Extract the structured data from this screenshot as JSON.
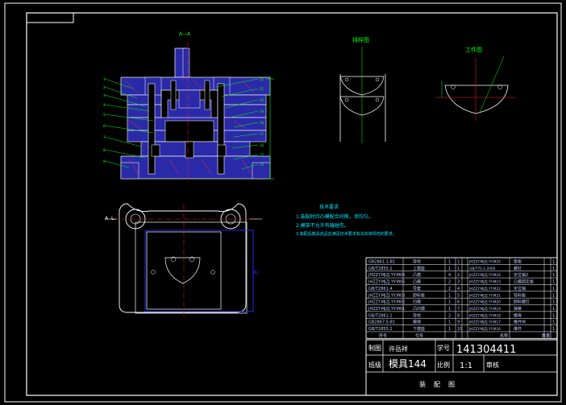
{
  "colors": {
    "background": "#000000",
    "frame": "#ffffff",
    "part_fill": "#2a2aa8",
    "part_line": "#ffffff",
    "leader": "#00ff00",
    "centerline": "#ff2020",
    "note_text": "#00e5ff",
    "table_row_text": "#c8c8ff",
    "title_text": "#ffffff"
  },
  "views": {
    "section_title": "A—A",
    "strip_layout_title": "排样图",
    "workpiece_title": "工件图",
    "section_marker_left": "A",
    "section_marker_left_letter": "L",
    "section_marker_right": "A",
    "section_marker_right_letter": "J"
  },
  "notes": {
    "title": "技术要求",
    "lines": [
      "1.装配时凹凸模配合间隙，须均匀。",
      "2.模架不允许有磕碰伤。",
      "3.装配后模具成品应满足技术要求有关标准规范的要求。"
    ]
  },
  "parts_table": {
    "left": [
      {
        "code": "GB2861.1-81",
        "name": "导柱",
        "qty": "1"
      },
      {
        "code": "GB/T2855.1",
        "name": "上模座",
        "qty": "1"
      },
      {
        "code": "JHZZY.MJZJ.YY.M06",
        "name": "凸模",
        "qty": "4"
      },
      {
        "code": "JHZZY.MJZJ.YY.M05",
        "name": "凸模",
        "qty": "2"
      },
      {
        "code": "GB/T2861.4",
        "name": "导套",
        "qty": "2"
      },
      {
        "code": "JHZZY.MJZJ.YY.M03",
        "name": "卸料板",
        "qty": "1"
      },
      {
        "code": "JHZZY.MJZJ.YY.M02",
        "name": "凹模",
        "qty": "1"
      },
      {
        "code": "JHZZY.MJZJ.YY.M01",
        "name": "凸凹模",
        "qty": "1"
      },
      {
        "code": "GB/T2861.1",
        "name": "导柱",
        "qty": "2"
      },
      {
        "code": "GB2867.5-81",
        "name": "模柄",
        "qty": "1"
      },
      {
        "code": "GB/T2855.2",
        "name": "下模座",
        "qty": "1"
      }
    ],
    "right": [
      {
        "idx": "1",
        "code": "JHZZY.MJZJ.YY.M25",
        "name": "垫板",
        "no": "1"
      },
      {
        "idx": "1",
        "code": "GB/T70.1-2000",
        "name": "螺钉",
        "no": "1"
      },
      {
        "idx": "2",
        "code": "JHZZY.MJZJ.YY.M24",
        "name": "定位销2",
        "no": "1"
      },
      {
        "idx": "3",
        "code": "JHZZY.MJZJ.YY.M23",
        "name": "凸模固定板",
        "no": "1"
      },
      {
        "idx": "4",
        "code": "JHZZY.MJZJ.YY.M22",
        "name": "定位销",
        "no": "1"
      },
      {
        "idx": "5",
        "code": "JHZZY.MJZJ.YY.M21",
        "name": "导料板",
        "no": "1"
      },
      {
        "idx": "6",
        "code": "JHZZY.MJZJ.YY.M20",
        "name": "卸料螺钉",
        "no": "1"
      },
      {
        "idx": "7",
        "code": "JHZZY.MJZJ.YY.M19",
        "name": "弹簧",
        "no": "1"
      },
      {
        "idx": "8",
        "code": "JHZZY.MJZJ.YY.M18",
        "name": "螺母",
        "no": "1"
      },
      {
        "idx": "9",
        "code": "JHZZY.MJZJ.YY.M17",
        "name": "推件块",
        "no": "1"
      },
      {
        "idx": "10",
        "code": "JHZZY.MJZJ.YY.M16",
        "name": "推杆",
        "no": "1"
      }
    ],
    "header": {
      "seq": "序号",
      "code": "代号",
      "name": "名称",
      "qty": "数量"
    }
  },
  "title_block": {
    "drawn_label": "制图",
    "drawn_value": "许岳祥",
    "student_no_label": "学号",
    "student_no_value": "141304411",
    "class_label": "班级",
    "class_value": "模具144",
    "scale_label": "比例",
    "scale_value": "1:1",
    "review_label": "审核",
    "drawing_name": "装配图"
  }
}
